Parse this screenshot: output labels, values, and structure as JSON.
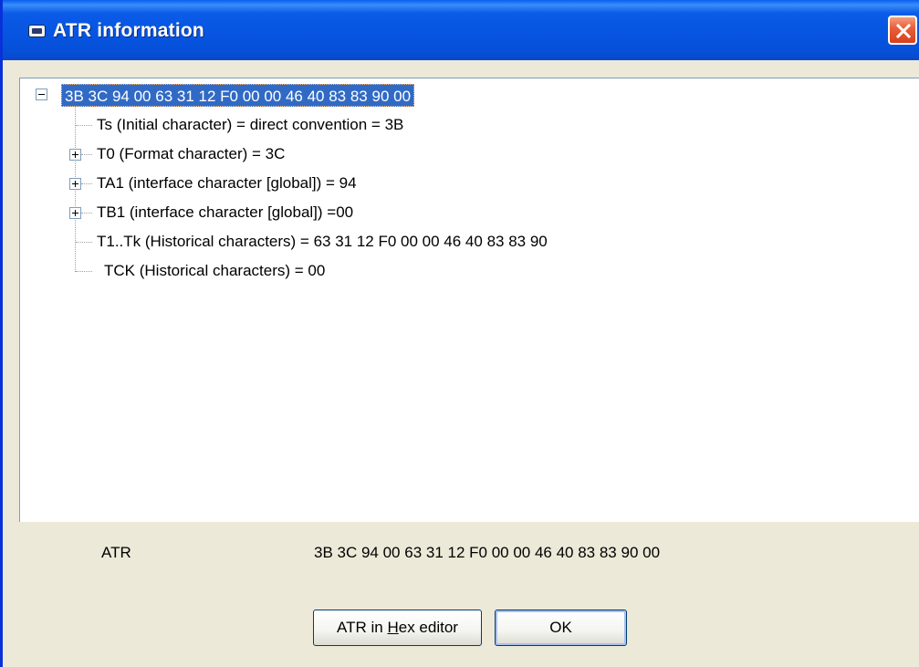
{
  "window": {
    "title": "ATR information"
  },
  "tree": {
    "root": "3B 3C 94 00 63 31 12 F0 00 00 46 40 83 83 90 00",
    "children": [
      {
        "label": "Ts (Initial character) = direct convention = 3B",
        "expandable": false
      },
      {
        "label": "T0 (Format character) = 3C",
        "expandable": true
      },
      {
        "label": "TA1 (interface character [global]) = 94",
        "expandable": true
      },
      {
        "label": "TB1 (interface character [global]) =00",
        "expandable": true
      },
      {
        "label": "T1..Tk (Historical characters) = 63 31 12 F0 00 00 46 40 83 83 90",
        "expandable": false
      },
      {
        "label": "TCK (Historical characters) = 00",
        "expandable": false
      }
    ]
  },
  "atr": {
    "caption": "ATR",
    "value": "3B 3C 94 00 63 31 12 F0 00 00 46 40 83 83 90 00"
  },
  "buttons": {
    "hex_editor_prefix": "ATR in ",
    "hex_editor_mnemonic": "H",
    "hex_editor_suffix": "ex editor",
    "ok": "OK"
  },
  "colors": {
    "title_bar": "#0654e0",
    "selection": "#316ac5",
    "dialog_bg": "#ece9d8",
    "close_button": "#d8401c"
  }
}
